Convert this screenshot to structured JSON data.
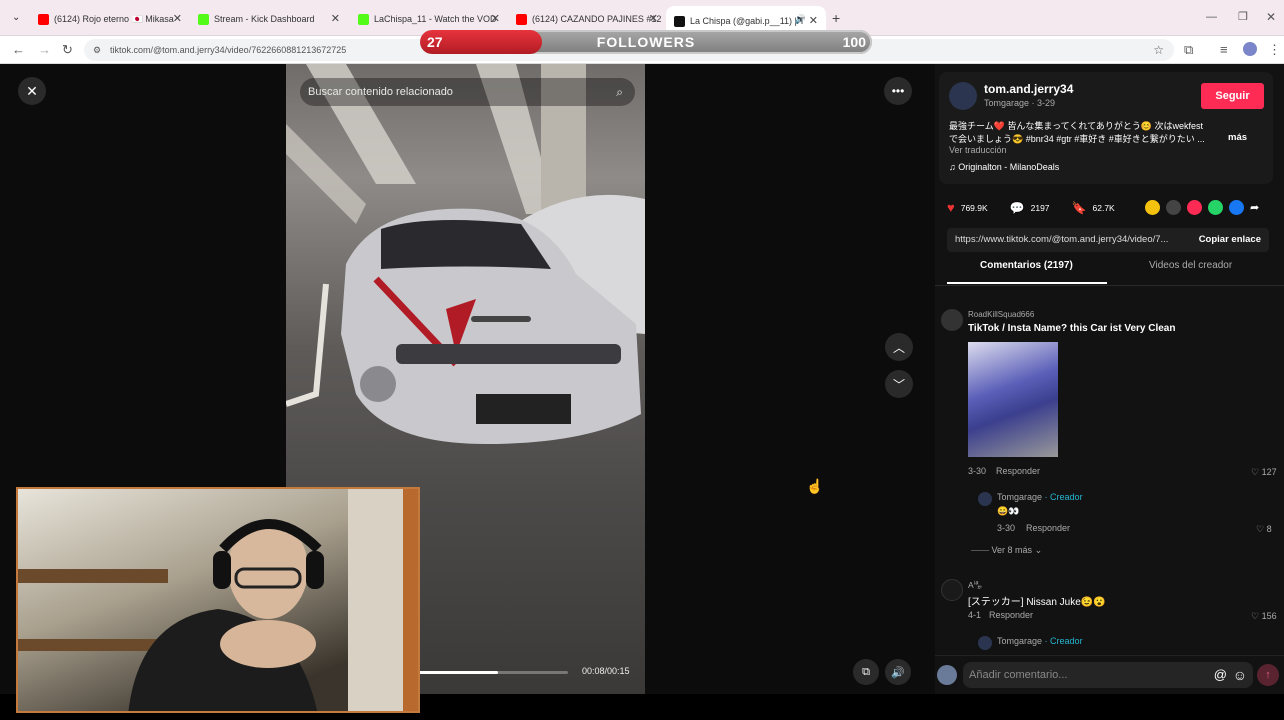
{
  "browser": {
    "tabs": [
      {
        "title": "(6124) Rojo eterno 🇯🇵 Mikasa",
        "fav_color": "#ff0000"
      },
      {
        "title": "Stream - Kick Dashboard",
        "fav_color": "#53fc18"
      },
      {
        "title": "LaChispa_11 - Watch the VOD",
        "fav_color": "#53fc18"
      },
      {
        "title": "(6124) CAZANDO PAJINES #12",
        "fav_color": "#ff0000"
      },
      {
        "title": "La Chispa (@gabi.p__11) | T",
        "fav_color": "#111111"
      }
    ],
    "new_tab": "+",
    "url": "tiktok.com/@tom.and.jerry34/video/7622660881213672725"
  },
  "goal": {
    "current": "27",
    "label": "FOLLOWERS",
    "target": "100",
    "progress": 0.27
  },
  "video": {
    "search_placeholder": "Buscar contenido relacionado",
    "time": "00:08/00:15",
    "progress": 0.53
  },
  "author": {
    "username": "tom.and.jerry34",
    "display": "Tomgarage · 3-29",
    "follow": "Seguir",
    "caption": "最強チーム❤️ 皆んな集まってくれてありがとう😊 次はwekfestで会いましょう😎 #bnr34 #gtr #車好き #車好きと繋がりたい ...",
    "more": "más",
    "translate": "Ver traducción",
    "music": "Originalton - MilanoDeals"
  },
  "stats": {
    "likes": "769.9K",
    "comments": "2197",
    "saves": "62.7K"
  },
  "share_colors": [
    "#f4c20d",
    "#444444",
    "#fe2c55",
    "#25d366",
    "#1877f2"
  ],
  "link": {
    "url": "https://www.tiktok.com/@tom.and.jerry34/video/7...",
    "copy": "Copiar enlace"
  },
  "tabs": {
    "comments": "Comentarios (2197)",
    "creator": "Videos del creador"
  },
  "comments": [
    {
      "user": "RoadKillSquad666",
      "text": "TikTok / Insta Name? this Car ist Very Clean",
      "date": "3-30",
      "reply": "Responder",
      "likes": "127"
    },
    {
      "user": "Tomgarage",
      "badge": "Creador",
      "text": "😀👀",
      "date": "3-30",
      "reply": "Responder",
      "likes": "8"
    },
    {
      "more": "Ver 8 más"
    },
    {
      "user": "A🈀",
      "text": "[ステッカー] Nissan Juke😉😮",
      "date": "4-1",
      "reply": "Responder",
      "likes": "156"
    },
    {
      "user": "Tomgarage",
      "badge": "Creador"
    }
  ],
  "comment_input": {
    "placeholder": "Añadir comentario...",
    "at": "@",
    "emoji": "☺"
  }
}
